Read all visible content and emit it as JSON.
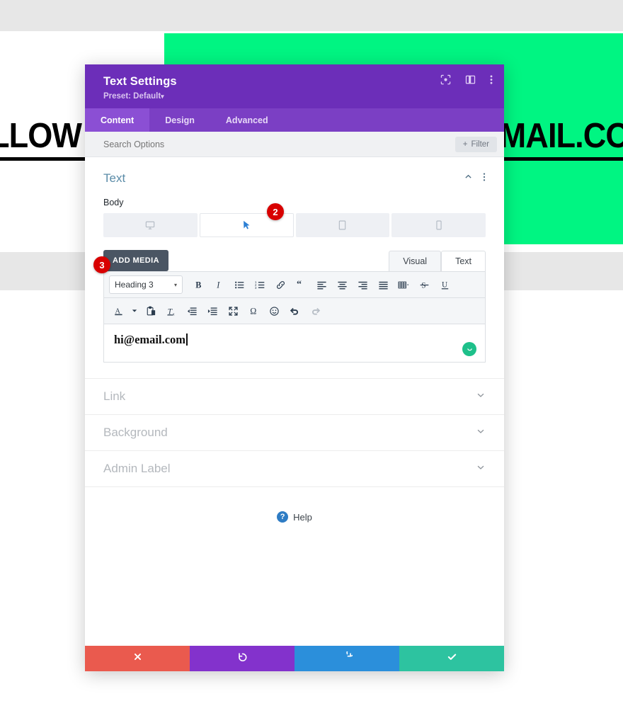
{
  "background": {
    "headline_left": "LLOW U",
    "headline_right": "EMAIL.CO",
    "green_color": "#00f582",
    "band_color": "#e7e7e7"
  },
  "modal": {
    "title": "Text Settings",
    "preset": "Preset: Default",
    "preset_caret": "▾",
    "header_icons": [
      {
        "name": "focus-target-icon"
      },
      {
        "name": "split-layout-icon"
      },
      {
        "name": "more-vertical-icon"
      }
    ],
    "tabs": [
      {
        "label": "Content",
        "active": true
      },
      {
        "label": "Design",
        "active": false
      },
      {
        "label": "Advanced",
        "active": false
      }
    ],
    "search": {
      "placeholder": "Search Options",
      "value": ""
    },
    "filter_button": "Filter",
    "filter_plus": "+",
    "section": {
      "title": "Text",
      "field_label": "Body"
    },
    "device_tabs": [
      {
        "name": "desktop",
        "active": false
      },
      {
        "name": "hover",
        "active": true
      },
      {
        "name": "tablet",
        "active": false
      },
      {
        "name": "phone",
        "active": false
      }
    ],
    "badges": [
      {
        "number": "2",
        "color": "#d80000"
      },
      {
        "number": "3",
        "color": "#d80000"
      }
    ],
    "editor": {
      "add_media": "ADD MEDIA",
      "modes": [
        {
          "label": "Visual",
          "active": true
        },
        {
          "label": "Text",
          "active": false
        }
      ],
      "format_select": "Heading 3",
      "format_caret": "▾",
      "toolbar_row1": [
        "bold-icon",
        "italic-icon",
        "bulleted-list-icon",
        "numbered-list-icon",
        "link-icon",
        "blockquote-icon",
        "align-left-icon",
        "align-center-icon",
        "align-right-icon",
        "align-justify-icon",
        "table-icon",
        "strikethrough-icon",
        "underline-icon"
      ],
      "toolbar_row2": [
        "text-color-icon",
        "paste-icon",
        "clear-formatting-icon",
        "outdent-icon",
        "indent-icon",
        "fullscreen-icon",
        "special-character-icon",
        "emoji-icon",
        "undo-icon",
        "redo-icon"
      ],
      "content": "hi@email.com",
      "status_icon": "smiley-icon"
    },
    "accordions": [
      {
        "label": "Link"
      },
      {
        "label": "Background"
      },
      {
        "label": "Admin Label"
      }
    ],
    "help": {
      "label": "Help",
      "glyph": "?"
    },
    "footer_buttons": [
      {
        "name": "cancel-button",
        "icon": "close-icon",
        "color": "#ea5a4e"
      },
      {
        "name": "undo-button",
        "icon": "undo-icon",
        "color": "#8332cc"
      },
      {
        "name": "redo-button",
        "icon": "redo-icon",
        "color": "#2b8fdb"
      },
      {
        "name": "save-button",
        "icon": "check-icon",
        "color": "#2dc3a0"
      }
    ]
  }
}
